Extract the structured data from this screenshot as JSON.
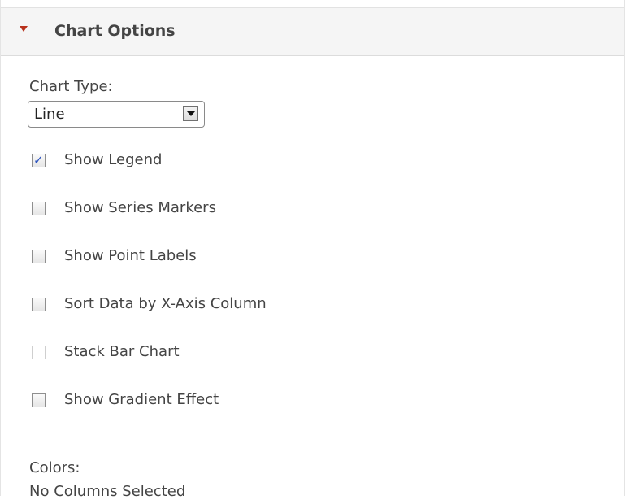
{
  "panel": {
    "title": "Chart Options",
    "collapse_icon": "triangle-down-icon"
  },
  "chart_type": {
    "label": "Chart Type:",
    "selected": "Line",
    "dropdown_icon": "dropdown-arrow-icon"
  },
  "options": [
    {
      "label": "Show Legend",
      "checked": true,
      "enabled": true
    },
    {
      "label": "Show Series Markers",
      "checked": false,
      "enabled": true
    },
    {
      "label": "Show Point Labels",
      "checked": false,
      "enabled": true
    },
    {
      "label": "Sort Data by X-Axis Column",
      "checked": false,
      "enabled": true
    },
    {
      "label": "Stack Bar Chart",
      "checked": false,
      "enabled": false
    },
    {
      "label": "Show Gradient Effect",
      "checked": false,
      "enabled": true
    }
  ],
  "colors": {
    "label": "Colors:",
    "value": "No Columns Selected"
  },
  "theme": {
    "accent": "#b8311c",
    "check": "#2a52be"
  }
}
